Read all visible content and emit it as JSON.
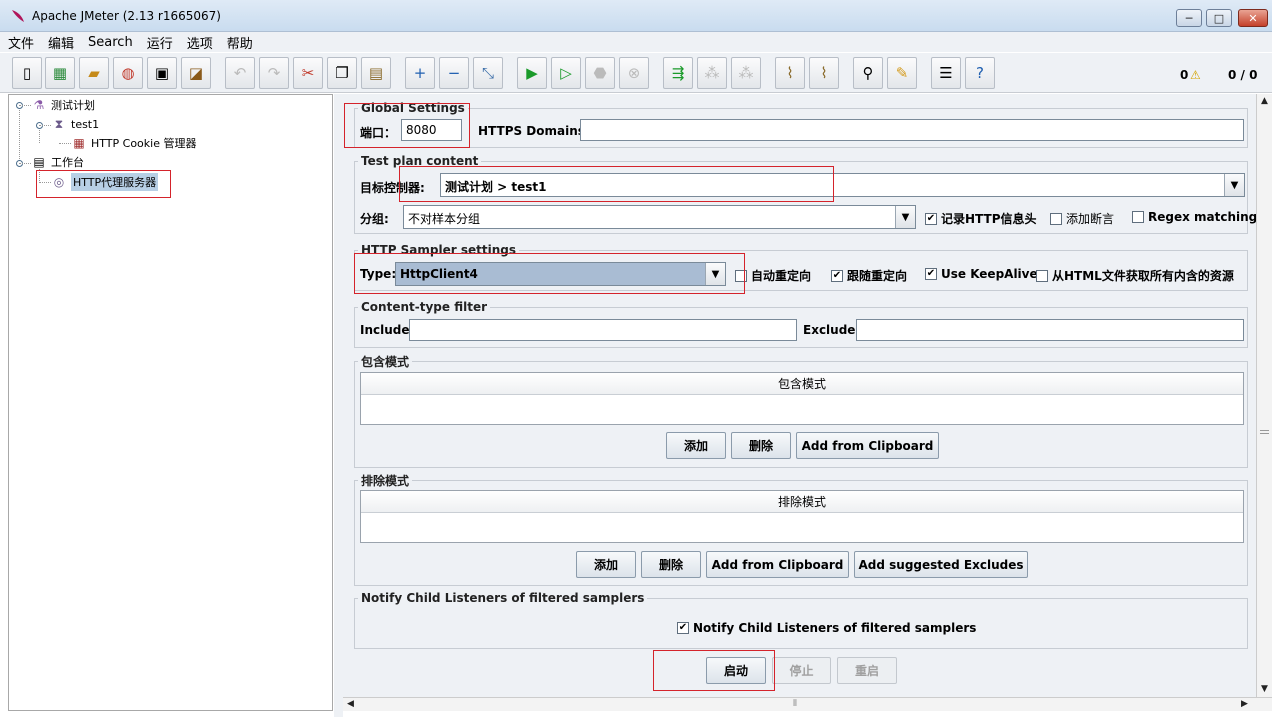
{
  "window": {
    "title": "Apache JMeter (2.13 r1665067)",
    "min": "─",
    "max": "□",
    "close": "✕"
  },
  "menu": [
    "文件",
    "编辑",
    "Search",
    "运行",
    "选项",
    "帮助"
  ],
  "toolbar": {
    "warn_count": "0",
    "thread_counter": "0 / 0"
  },
  "tree": {
    "test_plan": "测试计划",
    "thread_group": "test1",
    "cookie_manager": "HTTP Cookie 管理器",
    "workbench": "工作台",
    "proxy": "HTTP代理服务器"
  },
  "global": {
    "legend": "Global Settings",
    "port_label": "端口：",
    "port_value": "8080",
    "https_label": "HTTPS Domains :",
    "https_value": ""
  },
  "content": {
    "legend": "Test plan content",
    "target_label": "目标控制器:",
    "target_value": "测试计划 > test1",
    "group_label": "分组:",
    "group_value": "不对样本分组",
    "record_headers": "记录HTTP信息头",
    "add_assertions": "添加断言",
    "regex_matching": "Regex matching"
  },
  "sampler": {
    "legend": "HTTP Sampler settings",
    "type_label": "Type:",
    "type_value": "HttpClient4",
    "auto_redirect": "自动重定向",
    "follow_redirects": "跟随重定向",
    "keepalive": "Use KeepAlive",
    "embedded": "从HTML文件获取所有内含的资源"
  },
  "ctype": {
    "legend": "Content-type filter",
    "include_label": "Include:",
    "exclude_label": "Exclude:"
  },
  "include_patterns": {
    "legend": "包含模式",
    "header": "包含模式",
    "add": "添加",
    "delete": "删除",
    "clipboard": "Add from Clipboard"
  },
  "exclude_patterns": {
    "legend": "排除模式",
    "header": "排除模式",
    "add": "添加",
    "delete": "删除",
    "clipboard": "Add from Clipboard",
    "suggested": "Add suggested Excludes"
  },
  "notify": {
    "legend": "Notify Child Listeners of filtered samplers",
    "checkbox": "Notify Child Listeners of filtered samplers"
  },
  "controls": {
    "start": "启动",
    "stop": "停止",
    "restart": "重启"
  },
  "colors": {
    "highlight": "#d4232b",
    "selection": "#b8cfe5"
  }
}
